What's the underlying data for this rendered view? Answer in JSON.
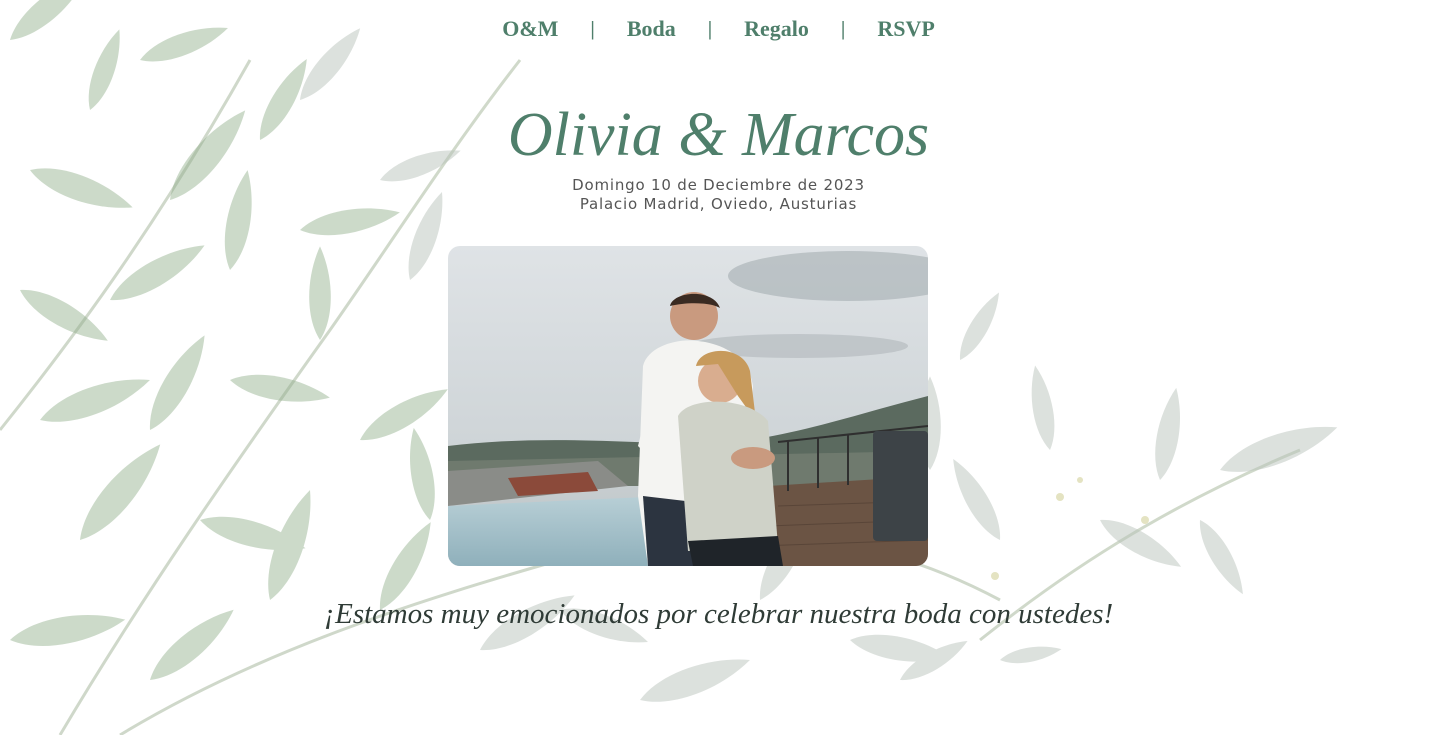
{
  "nav": {
    "items": [
      {
        "label": "O&M"
      },
      {
        "label": "Boda"
      },
      {
        "label": "Regalo"
      },
      {
        "label": "RSVP"
      }
    ],
    "separator": "|"
  },
  "hero": {
    "title": "Olivia & Marcos",
    "date": "Domingo 10 de Deciembre de 2023",
    "location": "Palacio Madrid, Oviedo, Austurias"
  },
  "tagline": "¡Estamos muy emocionados por celebrar nuestra boda con ustedes!",
  "colors": {
    "accent": "#4f7f6b",
    "text_dark": "#2f3b36",
    "subtext": "#555555",
    "leaf_green": "#8fae8a",
    "leaf_grey": "#b9c2bb"
  }
}
